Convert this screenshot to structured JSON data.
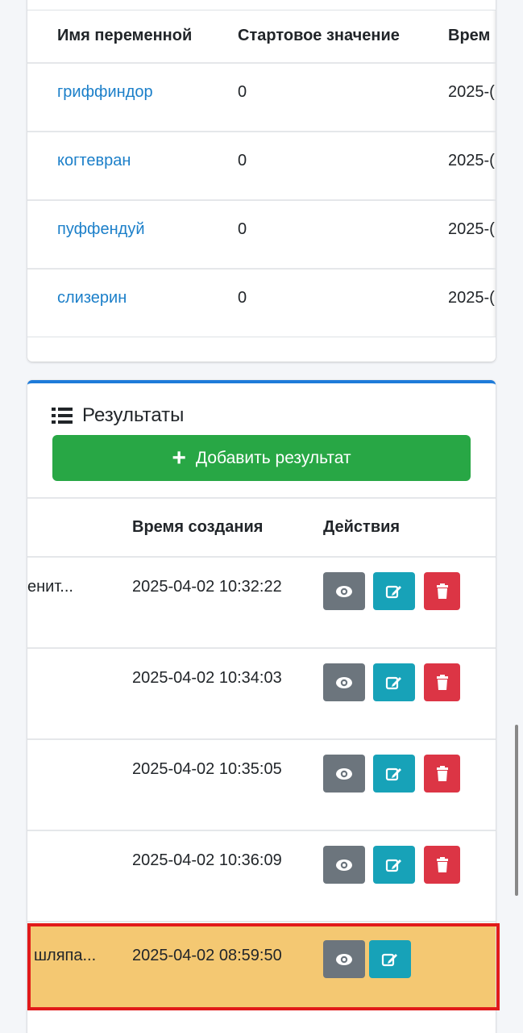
{
  "variables_table": {
    "headers": [
      "Имя переменной",
      "Стартовое значение",
      "Врем"
    ],
    "rows": [
      {
        "name": "гриффиндор",
        "start": "0",
        "time": "2025-("
      },
      {
        "name": "когтевран",
        "start": "0",
        "time": "2025-("
      },
      {
        "name": "пуффендуй",
        "start": "0",
        "time": "2025-("
      },
      {
        "name": "слизерин",
        "start": "0",
        "time": "2025-("
      }
    ]
  },
  "results": {
    "title": "Результаты",
    "add_button": "Добавить результат",
    "headers": [
      "Время создания",
      "Действия"
    ],
    "rows": [
      {
        "text": "енит...",
        "created": "2025-04-02 10:32:22"
      },
      {
        "text": "",
        "created": "2025-04-02 10:34:03"
      },
      {
        "text": "",
        "created": "2025-04-02 10:35:05"
      },
      {
        "text": "",
        "created": "2025-04-02 10:36:09"
      },
      {
        "text": "шляпа...",
        "created": "2025-04-02 08:59:50"
      }
    ]
  },
  "colors": {
    "accent": "#1e7bd9",
    "success": "#28a745",
    "view": "#6c757d",
    "edit": "#17a2b8",
    "delete": "#dc3545",
    "highlight": "#f4c872",
    "frame": "#e11a1a"
  },
  "icons": {
    "view": "eye-icon",
    "edit": "edit-icon",
    "delete": "trash-icon",
    "list": "list-icon",
    "add": "plus-icon"
  }
}
